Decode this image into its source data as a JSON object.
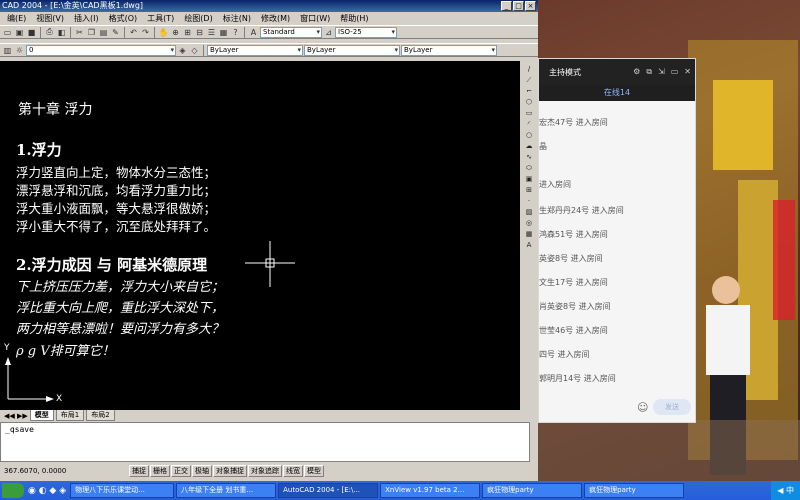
{
  "window": {
    "title": "CAD 2004 - [E:\\金英\\CAD黑板1.dwg]",
    "controls": [
      "_",
      "□",
      "×"
    ]
  },
  "menu": [
    "编(E)",
    "视图(V)",
    "插入(I)",
    "格式(O)",
    "工具(T)",
    "绘图(D)",
    "标注(N)",
    "修改(M)",
    "窗口(W)",
    "帮助(H)"
  ],
  "toolbar": {
    "text_style": "Standard",
    "dim_style": "ISO-25",
    "layer": "0",
    "color": "ByLayer",
    "linetype": "ByLayer",
    "lineweight": "ByLayer"
  },
  "drawing": {
    "chapter_title": "第十章 浮力",
    "section1_heading": "1.浮力",
    "section1_lines": [
      "浮力竖直向上定，物体水分三态性；",
      "漂浮悬浮和沉底，均看浮力重力比；",
      "浮大重小液面飘，等大悬浮很傲娇；",
      "浮小重大不得了，沉至底处拜拜了。"
    ],
    "section2_heading": "2.浮力成因 与 阿基米德原理",
    "section2_lines": [
      "下上挤压压力差，浮力大小来自它；",
      "浮比重大向上爬，重比浮大深处下，",
      "两力相等悬漂啦！要问浮力有多大？",
      "ρ g V排可算它！"
    ],
    "ucs_y": "Y",
    "ucs_x": "X"
  },
  "tabs": [
    "模型",
    "布局1",
    "布局2"
  ],
  "command": {
    "line": "_qsave"
  },
  "status": {
    "coords": "367.6070, 0.0000",
    "buttons": [
      "捕捉",
      "栅格",
      "正交",
      "极轴",
      "对象捕捉",
      "对象追踪",
      "线宽",
      "模型"
    ]
  },
  "chat": {
    "mode_label": "主持模式",
    "online_tab": "在线14",
    "messages": [
      "宏杰47号 进入房间",
      "晶",
      "进入房间",
      "生郑丹丹24号 进入房间",
      "鸿森51号 进入房间",
      "英姿8号 进入房间",
      "文生17号 进入房间",
      "肖英姿8号 进入房间",
      "世莹46号 进入房间",
      "四号 进入房间",
      "郭明月14号 进入房间"
    ],
    "send_label": "发送"
  },
  "taskbar": {
    "tasks": [
      "物理八下乐乐课堂动...",
      "八年级下全册 划书重...",
      "AutoCAD 2004 - [E:\\...",
      "XnView v1.97 beta 2...",
      "疯狂物理party",
      "疯狂物理party"
    ],
    "tray_text": "◀ 中"
  }
}
